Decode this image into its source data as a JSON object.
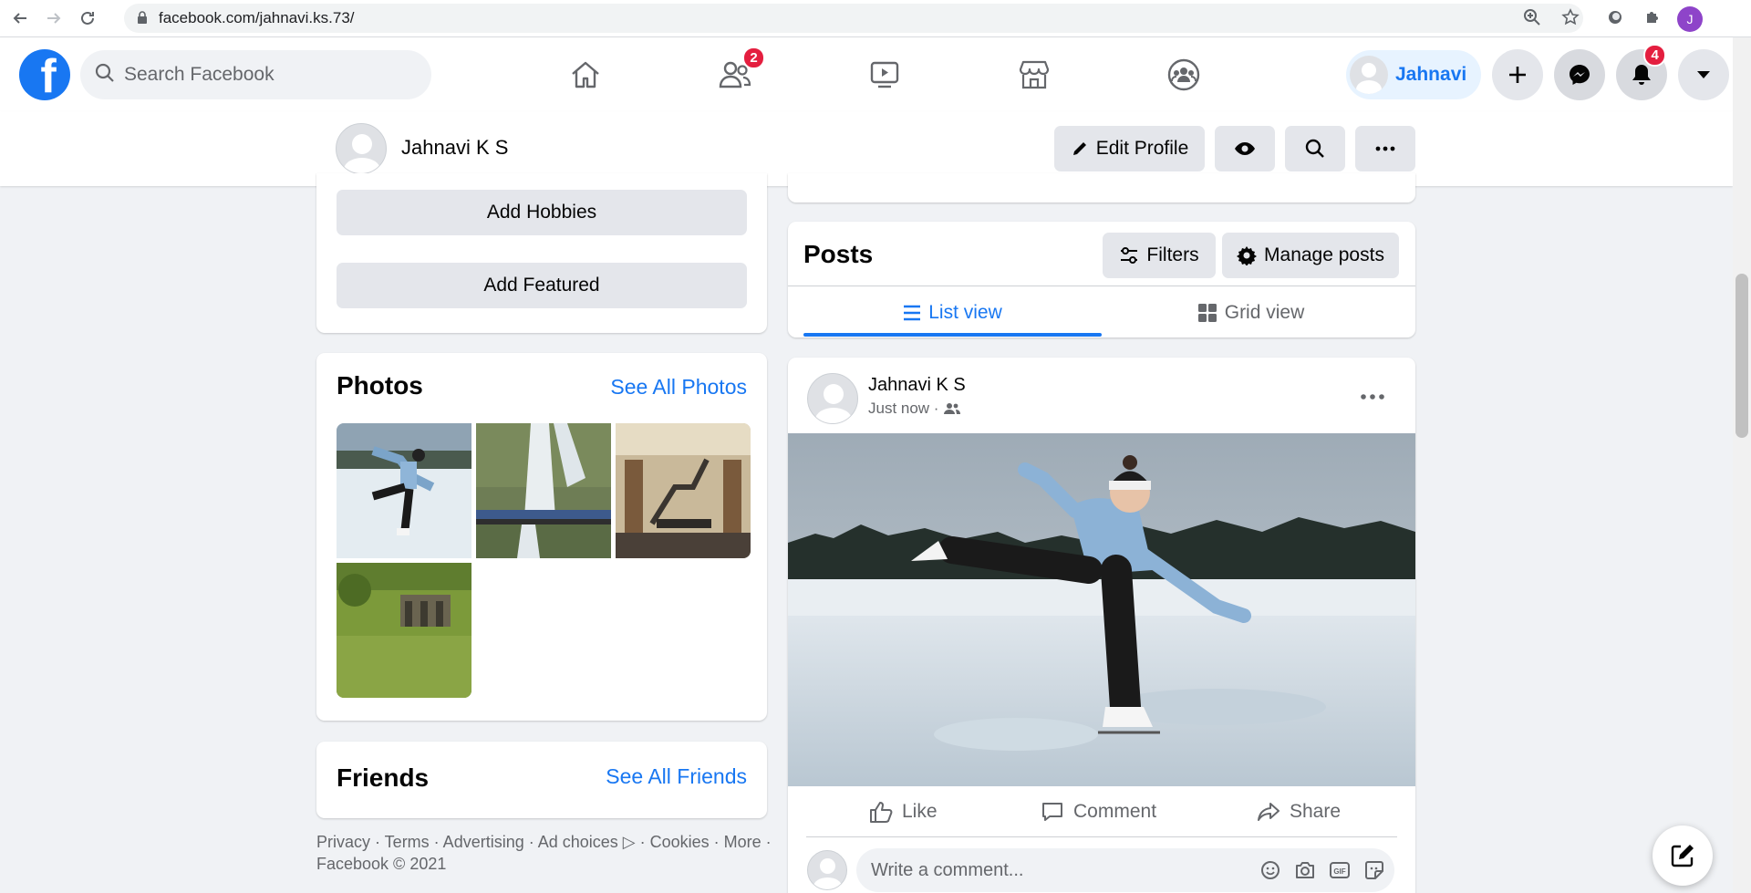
{
  "browser": {
    "url": "facebook.com/jahnavi.ks.73/",
    "profile_initial": "J"
  },
  "topbar": {
    "search_placeholder": "Search Facebook",
    "friends_badge": "2",
    "user_chip_name": "Jahnavi",
    "notifications_badge": "4",
    "brand_color": "#1877f2",
    "badge_color": "#e41e3f"
  },
  "profile_bar": {
    "name": "Jahnavi K S",
    "edit_label": "Edit Profile"
  },
  "intro": {
    "add_hobbies": "Add Hobbies",
    "add_featured": "Add Featured"
  },
  "photos": {
    "title": "Photos",
    "see_all": "See All Photos"
  },
  "friends": {
    "title": "Friends",
    "see_all": "See All Friends"
  },
  "footer": {
    "line1": "Privacy · Terms · Advertising · Ad choices ▷ · Cookies · More ·",
    "line2": "Facebook © 2021"
  },
  "posts": {
    "title": "Posts",
    "filters": "Filters",
    "manage": "Manage posts",
    "list_view": "List view",
    "grid_view": "Grid view"
  },
  "post": {
    "author": "Jahnavi K S",
    "time": "Just now ·",
    "like": "Like",
    "comment": "Comment",
    "share": "Share",
    "comment_placeholder": "Write a comment..."
  }
}
